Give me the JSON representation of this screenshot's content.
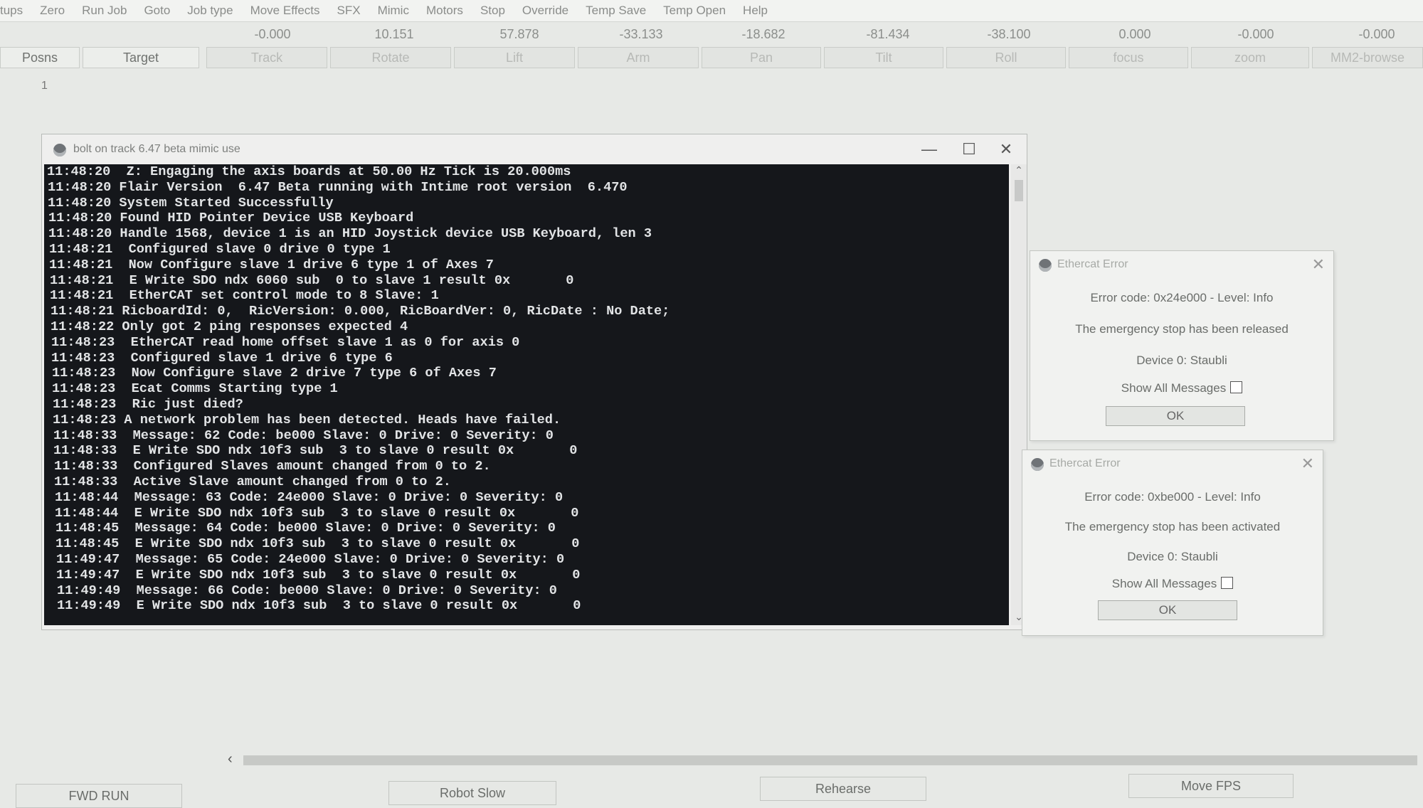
{
  "menu": [
    "tups",
    "Zero",
    "Run Job",
    "Goto",
    "Job type",
    "Move Effects",
    "SFX",
    "Mimic",
    "Motors",
    "Stop",
    "Override",
    "Temp Save",
    "Temp Open",
    "Help"
  ],
  "axis_values": [
    "-0.000",
    "10.151",
    "57.878",
    "-33.133",
    "-18.682",
    "-81.434",
    "-38.100",
    "0.000",
    "-0.000",
    "-0.000"
  ],
  "axis_buttons": [
    "Posns",
    "Target",
    "Track",
    "Rotate",
    "Lift",
    "Arm",
    "Pan",
    "Tilt",
    "Roll",
    "focus",
    "zoom",
    "MM2-browse"
  ],
  "row_number": "1",
  "console": {
    "title": "bolt on track 6.47 beta mimic use",
    "minimize_glyph": "—",
    "maximize_glyph": "☐",
    "close_glyph": "✕",
    "lines": [
      "11:48:20  Z: Engaging the axis boards at 50.00 Hz Tick is 20.000ms",
      "11:48:20 Flair Version  6.47 Beta running with Intime root version  6.470",
      "11:48:20 System Started Successfully",
      "11:48:20 Found HID Pointer Device USB Keyboard",
      "11:48:20 Handle 1568, device 1 is an HID Joystick device USB Keyboard, len 3",
      "11:48:21  Configured slave 0 drive 0 type 1",
      "11:48:21  Now Configure slave 1 drive 6 type 1 of Axes 7",
      "11:48:21  E Write SDO ndx 6060 sub  0 to slave 1 result 0x       0",
      "11:48:21  EtherCAT set control mode to 8 Slave: 1",
      "11:48:21 RicboardId: 0,  RicVersion: 0.000, RicBoardVer: 0, RicDate : No Date;",
      "11:48:22 Only got 2 ping responses expected 4",
      "11:48:23  EtherCAT read home offset slave 1 as 0 for axis 0",
      "11:48:23  Configured slave 1 drive 6 type 6",
      "11:48:23  Now Configure slave 2 drive 7 type 6 of Axes 7",
      "11:48:23  Ecat Comms Starting type 1",
      "11:48:23  Ric just died?",
      "11:48:23 A network problem has been detected. Heads have failed.",
      "11:48:33  Message: 62 Code: be000 Slave: 0 Drive: 0 Severity: 0",
      "11:48:33  E Write SDO ndx 10f3 sub  3 to slave 0 result 0x       0",
      "11:48:33  Configured Slaves amount changed from 0 to 2.",
      "11:48:33  Active Slave amount changed from 0 to 2.",
      "11:48:44  Message: 63 Code: 24e000 Slave: 0 Drive: 0 Severity: 0",
      "11:48:44  E Write SDO ndx 10f3 sub  3 to slave 0 result 0x       0",
      "11:48:45  Message: 64 Code: be000 Slave: 0 Drive: 0 Severity: 0",
      "11:48:45  E Write SDO ndx 10f3 sub  3 to slave 0 result 0x       0",
      "11:49:47  Message: 65 Code: 24e000 Slave: 0 Drive: 0 Severity: 0",
      "11:49:47  E Write SDO ndx 10f3 sub  3 to slave 0 result 0x       0",
      "11:49:49  Message: 66 Code: be000 Slave: 0 Drive: 0 Severity: 0",
      "11:49:49  E Write SDO ndx 10f3 sub  3 to slave 0 result 0x       0"
    ]
  },
  "dialog1": {
    "title": "Ethercat Error",
    "close_glyph": "✕",
    "code": "Error code: 0x24e000 - Level: Info",
    "message": "The emergency stop has been released",
    "device": "Device 0: Staubli",
    "show_all": "Show All Messages",
    "ok": "OK"
  },
  "dialog2": {
    "title": "Ethercat Error",
    "close_glyph": "✕",
    "code": "Error code: 0xbe000 - Level: Info",
    "message": "The emergency stop has been activated",
    "device": "Device 0: Staubli",
    "show_all": "Show All Messages",
    "ok": "OK"
  },
  "hscroll_left_glyph": "‹",
  "bottom_buttons": [
    "FWD RUN",
    "Robot Slow",
    "Rehearse",
    "Move FPS"
  ],
  "colors": {
    "console_bg": "#15171b",
    "console_text": "#e2e4e6",
    "window_bg": "#e7e9e6"
  }
}
